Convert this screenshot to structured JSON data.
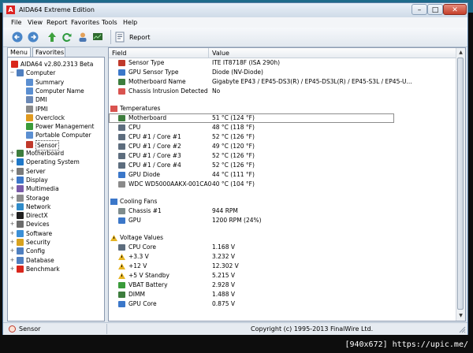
{
  "window": {
    "app_icon_text": "A",
    "title": "AIDA64 Extreme Edition",
    "min_glyph": "–",
    "max_glyph": "□",
    "close_glyph": "✕"
  },
  "menu": [
    "File",
    "View",
    "Report",
    "Favorites",
    "Tools",
    "Help"
  ],
  "toolbar": {
    "report_label": "Report"
  },
  "tabs": [
    "Menu",
    "Favorites"
  ],
  "tree": [
    {
      "label": "AIDA64 v2.80.2313 Beta",
      "level": 0,
      "exp": "",
      "icon": "aida64-icon",
      "color": "#d9261c"
    },
    {
      "label": "Computer",
      "level": 1,
      "exp": "−",
      "icon": "computer-icon",
      "color": "#4f7fc0"
    },
    {
      "label": "Summary",
      "level": 2,
      "exp": "",
      "icon": "summary-icon",
      "color": "#5b8fd1"
    },
    {
      "label": "Computer Name",
      "level": 2,
      "exp": "",
      "icon": "computer-name-icon",
      "color": "#5b8fd1"
    },
    {
      "label": "DMI",
      "level": 2,
      "exp": "",
      "icon": "dmi-icon",
      "color": "#6b89b6"
    },
    {
      "label": "IPMI",
      "level": 2,
      "exp": "",
      "icon": "ipmi-icon",
      "color": "#8a8a8a"
    },
    {
      "label": "Overclock",
      "level": 2,
      "exp": "",
      "icon": "overclock-icon",
      "color": "#e09a1f"
    },
    {
      "label": "Power Management",
      "level": 2,
      "exp": "",
      "icon": "power-icon",
      "color": "#3a9b3a"
    },
    {
      "label": "Portable Computer",
      "level": 2,
      "exp": "",
      "icon": "laptop-icon",
      "color": "#5b8fd1"
    },
    {
      "label": "Sensor",
      "level": 2,
      "exp": "",
      "icon": "sensor-icon",
      "color": "#c0392b",
      "selected": true
    },
    {
      "label": "Motherboard",
      "level": 1,
      "exp": "+",
      "icon": "motherboard-icon",
      "color": "#3d7d3d"
    },
    {
      "label": "Operating System",
      "level": 1,
      "exp": "+",
      "icon": "os-icon",
      "color": "#1f78c8"
    },
    {
      "label": "Server",
      "level": 1,
      "exp": "+",
      "icon": "server-icon",
      "color": "#7a7a7a"
    },
    {
      "label": "Display",
      "level": 1,
      "exp": "+",
      "icon": "display-icon",
      "color": "#3b77c9"
    },
    {
      "label": "Multimedia",
      "level": 1,
      "exp": "+",
      "icon": "multimedia-icon",
      "color": "#7a5aa8"
    },
    {
      "label": "Storage",
      "level": 1,
      "exp": "+",
      "icon": "storage-icon",
      "color": "#8a8a8a"
    },
    {
      "label": "Network",
      "level": 1,
      "exp": "+",
      "icon": "network-icon",
      "color": "#2f8bc9"
    },
    {
      "label": "DirectX",
      "level": 1,
      "exp": "+",
      "icon": "directx-icon",
      "color": "#202020"
    },
    {
      "label": "Devices",
      "level": 1,
      "exp": "+",
      "icon": "devices-icon",
      "color": "#6b6b6b"
    },
    {
      "label": "Software",
      "level": 1,
      "exp": "+",
      "icon": "software-icon",
      "color": "#3b8fd6"
    },
    {
      "label": "Security",
      "level": 1,
      "exp": "+",
      "icon": "security-icon",
      "color": "#d8a21f"
    },
    {
      "label": "Config",
      "level": 1,
      "exp": "+",
      "icon": "config-icon",
      "color": "#4f7fc0"
    },
    {
      "label": "Database",
      "level": 1,
      "exp": "+",
      "icon": "database-icon",
      "color": "#4f7fc0"
    },
    {
      "label": "Benchmark",
      "level": 1,
      "exp": "+",
      "icon": "benchmark-icon",
      "color": "#d9261c"
    }
  ],
  "columns": {
    "field": "Field",
    "value": "Value"
  },
  "rows": [
    {
      "type": "item",
      "icon": "chip-icon",
      "color": "#c0392b",
      "field": "Sensor Type",
      "value": "ITE IT8718F  (ISA 290h)"
    },
    {
      "type": "item",
      "icon": "gpu-icon",
      "color": "#3b77c9",
      "field": "GPU Sensor Type",
      "value": "Diode  (NV-Diode)"
    },
    {
      "type": "item",
      "icon": "motherboard-icon",
      "color": "#3d7d3d",
      "field": "Motherboard Name",
      "value": "Gigabyte EP43 / EP45-DS3(R) / EP45-DS3L(R) / EP45-S3L /  EP45-U..."
    },
    {
      "type": "item",
      "icon": "chassis-icon",
      "color": "#d9534f",
      "field": "Chassis Intrusion Detected",
      "value": "No"
    },
    {
      "type": "blank"
    },
    {
      "type": "group",
      "icon": "temperature-icon",
      "color": "#d9534f",
      "field": "Temperatures"
    },
    {
      "type": "item",
      "icon": "motherboard-icon",
      "color": "#3d7d3d",
      "field": "Motherboard",
      "value": "51 °C  (124 °F)",
      "highlight": true
    },
    {
      "type": "item",
      "icon": "cpu-icon",
      "color": "#5d6d7e",
      "field": "CPU",
      "value": "48 °C  (118 °F)"
    },
    {
      "type": "item",
      "icon": "cpu-icon",
      "color": "#5d6d7e",
      "field": "CPU #1 / Core #1",
      "value": "52 °C  (126 °F)"
    },
    {
      "type": "item",
      "icon": "cpu-icon",
      "color": "#5d6d7e",
      "field": "CPU #1 / Core #2",
      "value": "49 °C  (120 °F)"
    },
    {
      "type": "item",
      "icon": "cpu-icon",
      "color": "#5d6d7e",
      "field": "CPU #1 / Core #3",
      "value": "52 °C  (126 °F)"
    },
    {
      "type": "item",
      "icon": "cpu-icon",
      "color": "#5d6d7e",
      "field": "CPU #1 / Core #4",
      "value": "52 °C  (126 °F)"
    },
    {
      "type": "item",
      "icon": "gpu-icon",
      "color": "#3b77c9",
      "field": "GPU Diode",
      "value": "44 °C  (111 °F)"
    },
    {
      "type": "item",
      "icon": "disk-icon",
      "color": "#8a8a8a",
      "field": "WDC WD5000AAKX-001CA0",
      "value": "40 °C  (104 °F)"
    },
    {
      "type": "blank"
    },
    {
      "type": "group",
      "icon": "fan-icon",
      "color": "#3b77c9",
      "field": "Cooling Fans"
    },
    {
      "type": "item",
      "icon": "fan-icon",
      "color": "#7f8c8d",
      "field": "Chassis #1",
      "value": "944 RPM"
    },
    {
      "type": "item",
      "icon": "gpu-icon",
      "color": "#3b77c9",
      "field": "GPU",
      "value": "1200 RPM  (24%)"
    },
    {
      "type": "blank"
    },
    {
      "type": "group",
      "icon": "voltage-icon",
      "color": "#e6b422",
      "field": "Voltage Values"
    },
    {
      "type": "item",
      "icon": "cpu-icon",
      "color": "#5d6d7e",
      "field": "CPU Core",
      "value": "1.168 V"
    },
    {
      "type": "item",
      "icon": "warning-icon",
      "color": "#e6b422",
      "field": "+3.3 V",
      "value": "3.232 V"
    },
    {
      "type": "item",
      "icon": "warning-icon",
      "color": "#e6b422",
      "field": "+12 V",
      "value": "12.302 V"
    },
    {
      "type": "item",
      "icon": "warning-icon",
      "color": "#e6b422",
      "field": "+5 V Standby",
      "value": "5.215 V"
    },
    {
      "type": "item",
      "icon": "battery-icon",
      "color": "#3a9b3a",
      "field": "VBAT Battery",
      "value": "2.928 V"
    },
    {
      "type": "item",
      "icon": "dimm-icon",
      "color": "#3d7d3d",
      "field": "DIMM",
      "value": "1.488 V"
    },
    {
      "type": "item",
      "icon": "gpu-icon",
      "color": "#3b77c9",
      "field": "GPU Core",
      "value": "0.875 V"
    }
  ],
  "scrollbar": {
    "up_glyph": "▲",
    "down_glyph": "▼"
  },
  "status": {
    "left": "Sensor",
    "copyright": "Copyright (c) 1995-2013 FinalWire Ltd."
  },
  "watermark": "[940x672] https://upic.me/"
}
